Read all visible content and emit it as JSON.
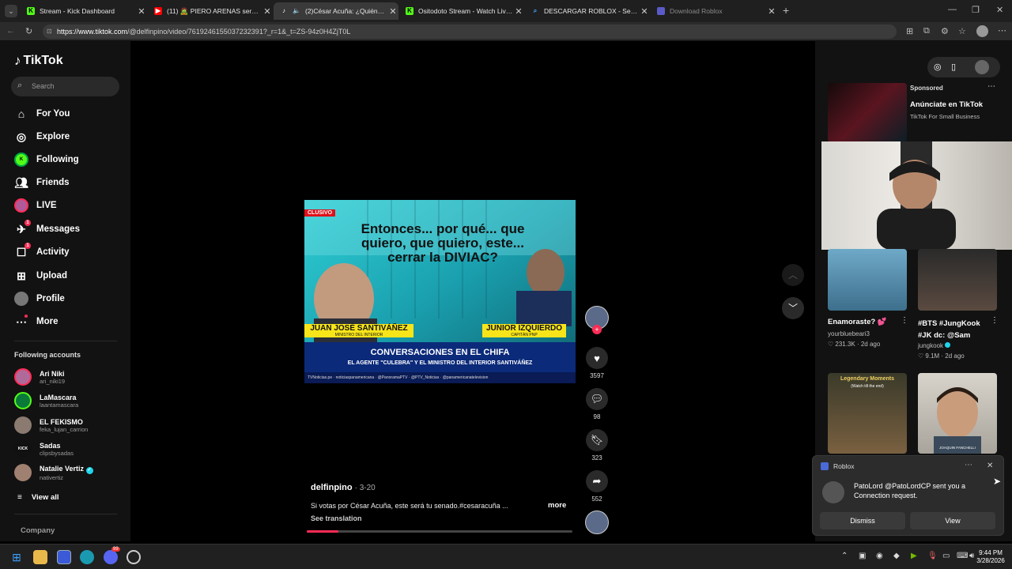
{
  "browser": {
    "tabs": [
      {
        "title": "Stream - Kick Dashboard",
        "icon": "kick-icon",
        "color": "#53fc18"
      },
      {
        "title": "(11) 🧟 PIERO ARENAS será ¿DEN",
        "icon": "youtube-icon",
        "color": "#ff0000"
      },
      {
        "title": "(2)César Acuña: ¿Quiénes inte",
        "icon": "tiktok-icon",
        "color": "#ffffff"
      },
      {
        "title": "Ositodoto Stream - Watch Live on",
        "icon": "kick-icon",
        "color": "#53fc18"
      },
      {
        "title": "DESCARGAR ROBLOX - Search",
        "icon": "bing-search-icon",
        "color": "#4aa3ff"
      },
      {
        "title": "Download Roblox",
        "icon": "roblox-icon",
        "color": "#7a7aff"
      }
    ],
    "url_host": "https://www.tiktok.com",
    "url_path": "/@delfinpino/video/7619246155037232391?_r=1&_t=ZS-94z0H4ZjT0L"
  },
  "sidebar": {
    "logo": "TikTok",
    "search_placeholder": "Search",
    "nav": [
      {
        "label": "For You",
        "icon": "home-icon"
      },
      {
        "label": "Explore",
        "icon": "compass-icon"
      },
      {
        "label": "Following",
        "icon": "following-avatar-icon"
      },
      {
        "label": "Friends",
        "icon": "friends-icon"
      },
      {
        "label": "LIVE",
        "icon": "live-avatar-icon"
      },
      {
        "label": "Messages",
        "icon": "messages-icon",
        "badge": "1"
      },
      {
        "label": "Activity",
        "icon": "activity-icon",
        "badge": "1"
      },
      {
        "label": "Upload",
        "icon": "upload-icon"
      },
      {
        "label": "Profile",
        "icon": "profile-avatar-icon"
      },
      {
        "label": "More",
        "icon": "more-icon"
      }
    ],
    "following_title": "Following accounts",
    "accounts": [
      {
        "name": "Ari Niki",
        "handle": "ari_niki19"
      },
      {
        "name": "LaMascara",
        "handle": "laantamascara"
      },
      {
        "name": "EL FEKISMO",
        "handle": "feka_lujan_carrion"
      },
      {
        "name": "Sadas",
        "handle": "clipsbysadas"
      },
      {
        "name": "Natalie Vertiz",
        "handle": "nativertiz",
        "verified": true
      }
    ],
    "view_all": "View all",
    "company": "Company"
  },
  "video": {
    "tag": "CLUSIVO",
    "headline": "Entonces... por qué... que quiero, que quiero, este... cerrar la DIVIAC?",
    "person_left": "JUAN JOSÉ SANTIVÁÑEZ",
    "person_left_role": "MINISTRO DEL INTERIOR",
    "person_right": "JUNIOR IZQUIERDO",
    "person_right_role": "CAPITÁN PNP",
    "banner": "CONVERSACIONES EN EL CHIFA",
    "subbanner": "EL AGENTE \"CULEBRA\" Y EL MINISTRO DEL INTERIOR SANTIVÁÑEZ",
    "footer": "TVNoticias.pe · noticiaspanamericana · @PanoramaPTV · @PTV_Noticias · @panamericanatelevision",
    "author": "delfinpino",
    "date": "· 3-20",
    "caption": "Si votas por César Acuña, este será tu senado.#cesaracuña ...",
    "more": "more",
    "see_translation": "See translation",
    "progress": 0.12
  },
  "actions": {
    "likes": "3597",
    "comments": "98",
    "saves": "323",
    "shares": "552"
  },
  "right": {
    "sponsored": "Sponsored",
    "ad_title": "Anúnciate en TikTok",
    "ad_sub": "TikTok For Small Business",
    "items": [
      {
        "title": "Enamoraste? 💕",
        "author": "yourbluebeari3",
        "meta": "♡ 231.3K · 2d ago"
      },
      {
        "title": "#BTS #JungKook #JK dc: @Sam",
        "author": "jungkook",
        "meta": "♡ 9.1M · 2d ago",
        "verified": true
      },
      {
        "title": "Legendary Moments",
        "subtitle": "(Watch till the end)"
      },
      {
        "title": "JOAQUIN FANCHELLI"
      }
    ]
  },
  "notification": {
    "app": "Roblox",
    "message": "PatoLord @PatoLordCP sent you a Connection request.",
    "dismiss": "Dismiss",
    "view": "View"
  },
  "taskbar": {
    "time": "9:44 PM",
    "date": "3/28/2026",
    "discord_badge": "99"
  },
  "colors": {
    "accent": "#fe2c55",
    "kick": "#53fc18",
    "bg": "#121212"
  }
}
